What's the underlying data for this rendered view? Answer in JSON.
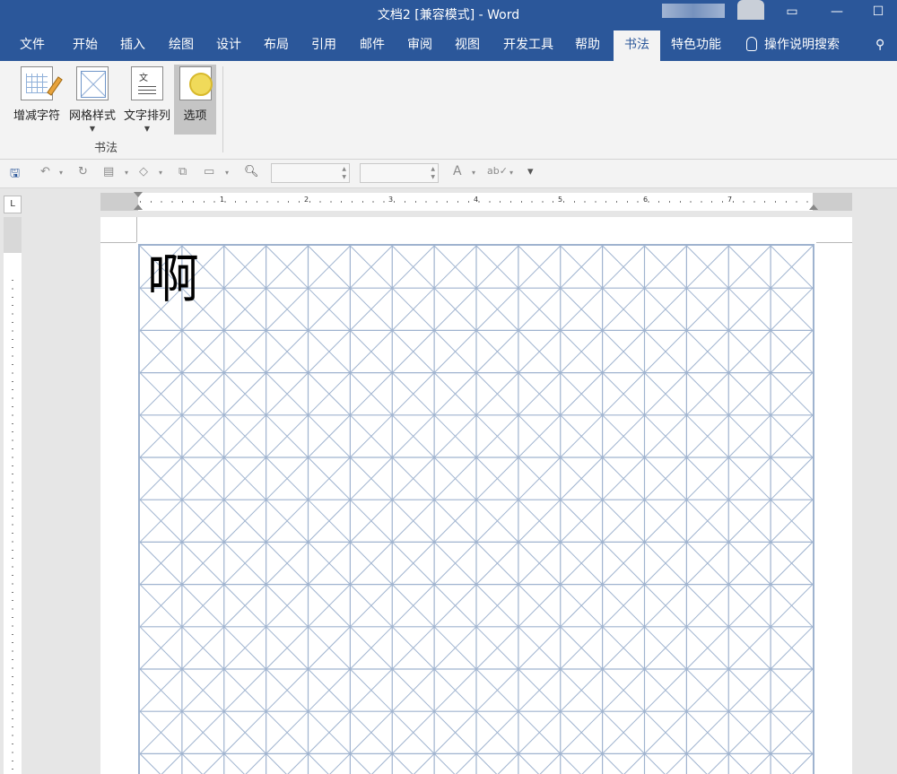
{
  "window": {
    "title": "文档2 [兼容模式]  -  Word",
    "controls": [
      "▭",
      "—",
      "☐"
    ]
  },
  "tabs": [
    "文件",
    "开始",
    "插入",
    "绘图",
    "设计",
    "布局",
    "引用",
    "邮件",
    "审阅",
    "视图",
    "开发工具",
    "帮助",
    "书法",
    "特色功能"
  ],
  "active_tab": "书法",
  "tell_me": "操作说明搜索",
  "share_icon": "person-icon",
  "ribbon": {
    "buttons": [
      {
        "label": "增减字符",
        "icon": "add-remove-chars-icon",
        "has_arrow": false
      },
      {
        "label": "网格样式",
        "icon": "grid-style-icon",
        "has_arrow": true
      },
      {
        "label": "文字排列",
        "icon": "text-arrange-icon",
        "has_arrow": true
      },
      {
        "label": "选项",
        "icon": "options-icon",
        "has_arrow": false
      }
    ],
    "group_label": "书法"
  },
  "qat": {
    "icons": [
      "save-icon",
      "undo-icon",
      "undo-dropdown-icon",
      "redo-icon",
      "print-layout-icon",
      "dropdown-icon",
      "shapes-icon",
      "dropdown-icon",
      "copy-icon",
      "textbox-icon",
      "dropdown-icon",
      "print-preview-icon"
    ],
    "font_name": "",
    "font_size": "",
    "font_color_glyph": "A",
    "spelling_glyph": "ab✓",
    "customize_glyph": "▾"
  },
  "ruler": {
    "tab_selector": "L",
    "numbers": [
      "1",
      "2",
      "3",
      "4",
      "5",
      "6",
      "7"
    ]
  },
  "document": {
    "character": "啊",
    "grid_columns": 16,
    "grid_rows": 13,
    "grid_color": "#9fb3cf"
  },
  "colors": {
    "accent": "#2b579a",
    "ribbon_bg": "#f3f3f3",
    "workspace_bg": "#e6e6e6"
  }
}
